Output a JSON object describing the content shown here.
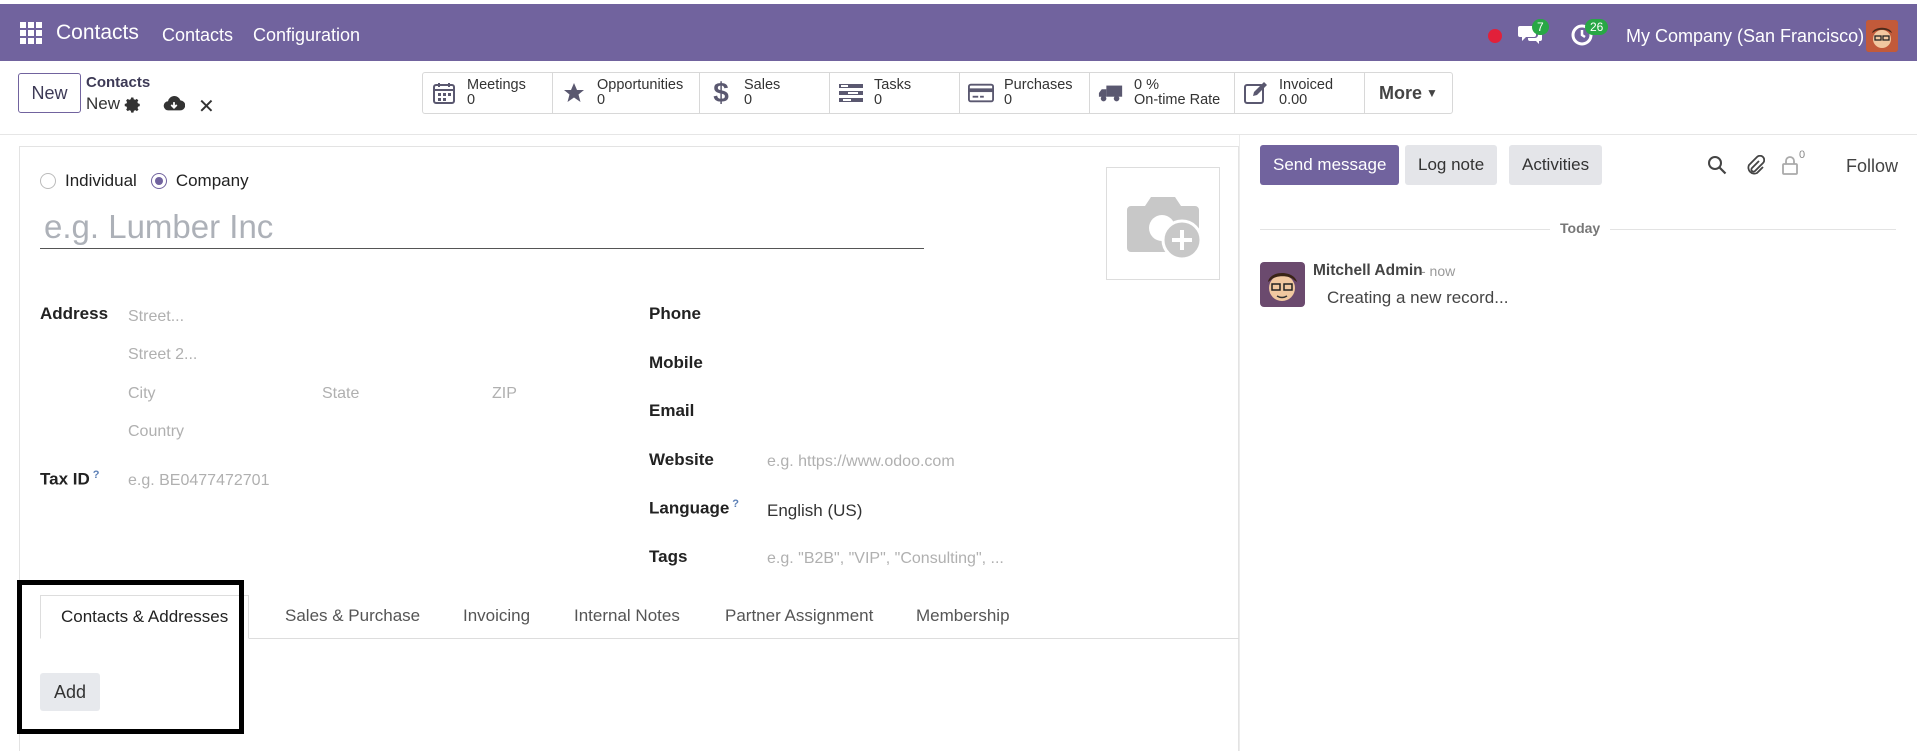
{
  "navbar": {
    "app_name": "Contacts",
    "menu": [
      "Contacts",
      "Configuration"
    ],
    "messages_count": "7",
    "activities_count": "26",
    "company": "My Company (San Francisco)"
  },
  "control_panel": {
    "new_label": "New",
    "breadcrumb_parent": "Contacts",
    "breadcrumb_current": "New",
    "smart_buttons": [
      {
        "icon": "calendar-icon",
        "label": "Meetings",
        "value": "0"
      },
      {
        "icon": "star-icon",
        "label": "Opportunities",
        "value": "0"
      },
      {
        "icon": "dollar-icon",
        "label": "Sales",
        "value": "0"
      },
      {
        "icon": "tasks-icon",
        "label": "Tasks",
        "value": "0"
      },
      {
        "icon": "credit-card-icon",
        "label": "Purchases",
        "value": "0"
      },
      {
        "icon": "truck-icon",
        "label": "0 %",
        "value": "On-time Rate"
      },
      {
        "icon": "invoice-edit-icon",
        "label": "Invoiced",
        "value": "0.00"
      }
    ],
    "more_label": "More"
  },
  "form": {
    "type_options": [
      "Individual",
      "Company"
    ],
    "selected_type": "Company",
    "name_placeholder": "e.g. Lumber Inc",
    "address_label": "Address",
    "street_placeholder": "Street...",
    "street2_placeholder": "Street 2...",
    "city_placeholder": "City",
    "state_placeholder": "State",
    "zip_placeholder": "ZIP",
    "country_placeholder": "Country",
    "tax_id_label": "Tax ID",
    "tax_id_help": "?",
    "tax_id_placeholder": "e.g. BE0477472701",
    "phone_label": "Phone",
    "mobile_label": "Mobile",
    "email_label": "Email",
    "website_label": "Website",
    "website_placeholder": "e.g. https://www.odoo.com",
    "language_label": "Language",
    "language_help": "?",
    "language_value": "English (US)",
    "tags_label": "Tags",
    "tags_placeholder": "e.g. \"B2B\", \"VIP\", \"Consulting\", ..."
  },
  "tabs": [
    "Contacts & Addresses",
    "Sales & Purchase",
    "Invoicing",
    "Internal Notes",
    "Partner Assignment",
    "Membership"
  ],
  "active_tab": "Contacts & Addresses",
  "add_label": "Add",
  "chatter": {
    "send_message": "Send message",
    "log_note": "Log note",
    "activities": "Activities",
    "followers_count": "0",
    "follow_label": "Follow",
    "date_separator": "Today",
    "message": {
      "author": "Mitchell Admin",
      "time": "- now",
      "body": "Creating a new record..."
    }
  },
  "colors": {
    "brand": "#71639e",
    "badge_green": "#28a745",
    "record_red": "#e2203a"
  }
}
